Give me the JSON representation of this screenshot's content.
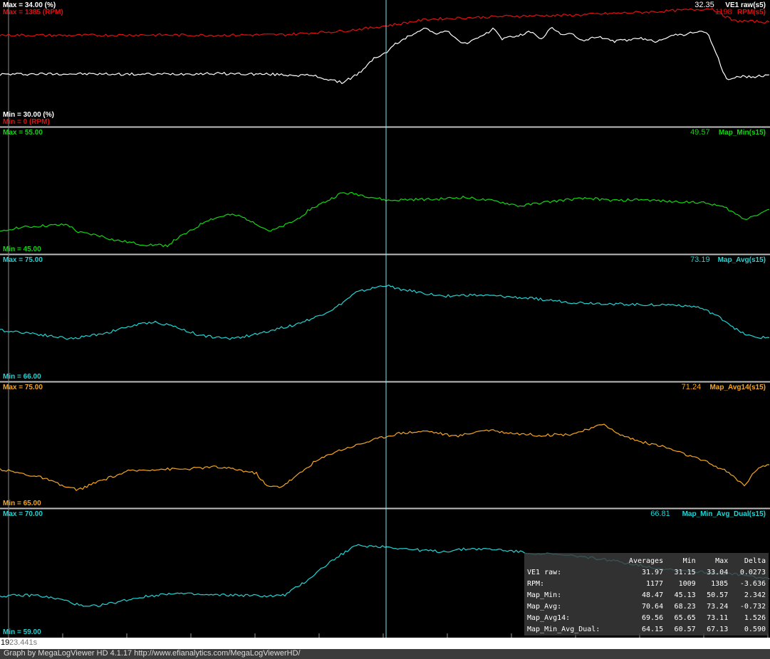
{
  "colors": {
    "white": "#ffffff",
    "red": "#e01010",
    "green": "#11d611",
    "cyan": "#22d4d4",
    "orange": "#f5a623"
  },
  "cursor_time_label": "23.441s",
  "cursor_zero_label": "19",
  "footer_text": "Graph by MegaLogViewer HD 4.1.17 http://www.efianalytics.com/MegaLogViewerHD/",
  "chart_data": [
    {
      "type": "line",
      "panel": 1,
      "series": [
        {
          "name": "VE1 raw(s5)",
          "color": "#ffffff",
          "max_label": "Max = 34.00 (%)",
          "min_label": "Min = 30.00 (%)",
          "cursor_value": "32.35",
          "ylim": [
            30,
            34
          ],
          "points": [
            [
              0,
              31.6
            ],
            [
              80,
              31.62
            ],
            [
              200,
              31.6
            ],
            [
              300,
              31.63
            ],
            [
              380,
              31.6
            ],
            [
              440,
              31.55
            ],
            [
              470,
              31.35
            ],
            [
              480,
              31.3
            ],
            [
              495,
              31.5
            ],
            [
              510,
              31.75
            ],
            [
              525,
              32.2
            ],
            [
              540,
              32.35
            ],
            [
              555,
              32.7
            ],
            [
              575,
              33.0
            ],
            [
              595,
              33.3
            ],
            [
              610,
              33.1
            ],
            [
              630,
              33.15
            ],
            [
              650,
              32.7
            ],
            [
              665,
              32.85
            ],
            [
              680,
              33.0
            ],
            [
              692,
              33.3
            ],
            [
              705,
              32.9
            ],
            [
              725,
              33.0
            ],
            [
              745,
              33.15
            ],
            [
              760,
              32.9
            ],
            [
              775,
              33.3
            ],
            [
              790,
              33.05
            ],
            [
              805,
              33.05
            ],
            [
              820,
              32.8
            ],
            [
              840,
              33.0
            ],
            [
              860,
              32.8
            ],
            [
              880,
              32.85
            ],
            [
              900,
              32.9
            ],
            [
              920,
              32.8
            ],
            [
              940,
              33.0
            ],
            [
              960,
              33.05
            ],
            [
              985,
              33.2
            ],
            [
              995,
              33.0
            ],
            [
              1005,
              32.4
            ],
            [
              1015,
              31.7
            ],
            [
              1020,
              31.42
            ],
            [
              1040,
              31.52
            ],
            [
              1060,
              31.5
            ],
            [
              1080,
              31.58
            ]
          ]
        },
        {
          "name": "RPM(s5)",
          "color": "#e01010",
          "max_label": "Max = 1385 (RPM)",
          "min_label": "Min = 0 (RPM)",
          "cursor_value": "1198",
          "ylim": [
            0,
            1385
          ],
          "points": [
            [
              0,
              1050
            ],
            [
              100,
              1045
            ],
            [
              200,
              1052
            ],
            [
              300,
              1048
            ],
            [
              400,
              1055
            ],
            [
              440,
              1080
            ],
            [
              480,
              1100
            ],
            [
              520,
              1140
            ],
            [
              560,
              1190
            ],
            [
              600,
              1250
            ],
            [
              660,
              1270
            ],
            [
              720,
              1290
            ],
            [
              800,
              1300
            ],
            [
              850,
              1320
            ],
            [
              880,
              1330
            ],
            [
              920,
              1345
            ],
            [
              960,
              1365
            ],
            [
              1000,
              1385
            ],
            [
              1012,
              1320
            ],
            [
              1030,
              1230
            ],
            [
              1080,
              1215
            ]
          ]
        }
      ]
    },
    {
      "type": "line",
      "panel": 2,
      "series": [
        {
          "name": "Map_Min(s15)",
          "color": "#11d611",
          "max_label": "Max = 55.00",
          "min_label": "Min = 45.00",
          "cursor_value": "49.57",
          "ylim": [
            45,
            55
          ],
          "points": [
            [
              0,
              46.2
            ],
            [
              20,
              46.6
            ],
            [
              60,
              46.8
            ],
            [
              95,
              46.9
            ],
            [
              110,
              46.2
            ],
            [
              140,
              45.9
            ],
            [
              160,
              45.5
            ],
            [
              200,
              45.1
            ],
            [
              235,
              45.0
            ],
            [
              250,
              45.7
            ],
            [
              270,
              46.4
            ],
            [
              290,
              47.3
            ],
            [
              320,
              47.8
            ],
            [
              335,
              47.7
            ],
            [
              355,
              47.2
            ],
            [
              370,
              46.6
            ],
            [
              380,
              46.3
            ],
            [
              395,
              46.7
            ],
            [
              415,
              47.3
            ],
            [
              435,
              48.3
            ],
            [
              460,
              49.1
            ],
            [
              480,
              49.8
            ],
            [
              500,
              49.7
            ],
            [
              515,
              49.5
            ],
            [
              545,
              49.1
            ],
            [
              575,
              49.2
            ],
            [
              610,
              49.2
            ],
            [
              650,
              49.4
            ],
            [
              675,
              49.2
            ],
            [
              700,
              49.0
            ],
            [
              730,
              48.6
            ],
            [
              760,
              48.9
            ],
            [
              800,
              49.2
            ],
            [
              830,
              49.3
            ],
            [
              860,
              49.1
            ],
            [
              900,
              49.2
            ],
            [
              940,
              49.0
            ],
            [
              970,
              49.0
            ],
            [
              1000,
              48.8
            ],
            [
              1020,
              48.4
            ],
            [
              1045,
              47.4
            ],
            [
              1065,
              47.9
            ],
            [
              1080,
              48.3
            ]
          ]
        }
      ]
    },
    {
      "type": "line",
      "panel": 3,
      "series": [
        {
          "name": "Map_Avg(s15)",
          "color": "#22d4d4",
          "max_label": "Max = 75.00",
          "min_label": "Min = 66.00",
          "cursor_value": "73.19",
          "ylim": [
            66,
            75
          ],
          "points": [
            [
              0,
              69.5
            ],
            [
              40,
              69.3
            ],
            [
              75,
              69.0
            ],
            [
              100,
              68.8
            ],
            [
              150,
              69.3
            ],
            [
              180,
              69.8
            ],
            [
              215,
              70.2
            ],
            [
              240,
              69.9
            ],
            [
              280,
              69.1
            ],
            [
              320,
              68.8
            ],
            [
              355,
              69.1
            ],
            [
              380,
              69.5
            ],
            [
              410,
              69.9
            ],
            [
              440,
              70.5
            ],
            [
              470,
              71.3
            ],
            [
              500,
              72.6
            ],
            [
              520,
              72.9
            ],
            [
              540,
              73.2
            ],
            [
              560,
              72.9
            ],
            [
              600,
              72.5
            ],
            [
              620,
              72.3
            ],
            [
              660,
              72.4
            ],
            [
              700,
              72.3
            ],
            [
              750,
              72.1
            ],
            [
              800,
              71.8
            ],
            [
              850,
              71.7
            ],
            [
              900,
              71.6
            ],
            [
              950,
              71.6
            ],
            [
              980,
              71.4
            ],
            [
              1000,
              70.9
            ],
            [
              1020,
              70.2
            ],
            [
              1040,
              69.3
            ],
            [
              1060,
              68.9
            ],
            [
              1080,
              68.9
            ]
          ]
        }
      ]
    },
    {
      "type": "line",
      "panel": 4,
      "series": [
        {
          "name": "Map_Avg14(s15)",
          "color": "#f5a623",
          "max_label": "Max = 75.00",
          "min_label": "Min = 65.00",
          "cursor_value": "71.24",
          "ylim": [
            65,
            75
          ],
          "points": [
            [
              0,
              67.8
            ],
            [
              30,
              67.4
            ],
            [
              60,
              67.0
            ],
            [
              90,
              66.2
            ],
            [
              110,
              65.9
            ],
            [
              140,
              66.7
            ],
            [
              180,
              67.6
            ],
            [
              220,
              67.8
            ],
            [
              260,
              67.8
            ],
            [
              300,
              68.0
            ],
            [
              330,
              67.8
            ],
            [
              360,
              67.4
            ],
            [
              375,
              66.2
            ],
            [
              395,
              66.2
            ],
            [
              415,
              67.1
            ],
            [
              440,
              68.4
            ],
            [
              470,
              69.4
            ],
            [
              500,
              70.0
            ],
            [
              530,
              70.6
            ],
            [
              560,
              71.1
            ],
            [
              600,
              71.3
            ],
            [
              640,
              70.8
            ],
            [
              680,
              71.4
            ],
            [
              720,
              71.1
            ],
            [
              760,
              70.9
            ],
            [
              800,
              71.0
            ],
            [
              830,
              71.5
            ],
            [
              848,
              72.0
            ],
            [
              865,
              71.1
            ],
            [
              900,
              70.3
            ],
            [
              930,
              69.9
            ],
            [
              960,
              69.2
            ],
            [
              990,
              68.5
            ],
            [
              1020,
              67.6
            ],
            [
              1045,
              66.3
            ],
            [
              1065,
              68.0
            ],
            [
              1080,
              68.2
            ]
          ]
        }
      ]
    },
    {
      "type": "line",
      "panel": 5,
      "series": [
        {
          "name": "Map_Min_Avg_Dual(s15)",
          "color": "#22d4d4",
          "max_label": "Max = 70.00",
          "min_label": "Min = 59.00",
          "cursor_value": "66.81",
          "ylim": [
            59,
            70
          ],
          "points": [
            [
              0,
              62.2
            ],
            [
              50,
              62.3
            ],
            [
              90,
              61.8
            ],
            [
              120,
              61.1
            ],
            [
              150,
              61.4
            ],
            [
              190,
              62.0
            ],
            [
              240,
              62.5
            ],
            [
              290,
              62.3
            ],
            [
              330,
              62.3
            ],
            [
              380,
              62.2
            ],
            [
              400,
              62.3
            ],
            [
              430,
              63.7
            ],
            [
              460,
              65.4
            ],
            [
              485,
              66.6
            ],
            [
              500,
              67.2
            ],
            [
              540,
              67.1
            ],
            [
              580,
              66.8
            ],
            [
              620,
              66.6
            ],
            [
              660,
              66.9
            ],
            [
              700,
              66.8
            ],
            [
              740,
              66.5
            ],
            [
              780,
              66.3
            ],
            [
              820,
              66.1
            ],
            [
              870,
              65.6
            ],
            [
              920,
              65.0
            ],
            [
              980,
              64.6
            ],
            [
              1040,
              64.3
            ],
            [
              1080,
              63.9
            ]
          ]
        }
      ]
    }
  ],
  "stats_table": {
    "headers": [
      "",
      "Averages",
      "Min",
      "Max",
      "Delta"
    ],
    "rows": [
      {
        "name": "VE1 raw:",
        "avg": "31.97",
        "min": "31.15",
        "max": "33.04",
        "delta": "0.0273"
      },
      {
        "name": "RPM:",
        "avg": "1177",
        "min": "1009",
        "max": "1385",
        "delta": "-3.636"
      },
      {
        "name": "Map_Min:",
        "avg": "48.47",
        "min": "45.13",
        "max": "50.57",
        "delta": "2.342"
      },
      {
        "name": "Map_Avg:",
        "avg": "70.64",
        "min": "68.23",
        "max": "73.24",
        "delta": "-0.732"
      },
      {
        "name": "Map_Avg14:",
        "avg": "69.56",
        "min": "65.65",
        "max": "73.11",
        "delta": "1.526"
      },
      {
        "name": "Map_Min_Avg_Dual:",
        "avg": "64.15",
        "min": "60.57",
        "max": "67.13",
        "delta": "0.590"
      }
    ]
  }
}
